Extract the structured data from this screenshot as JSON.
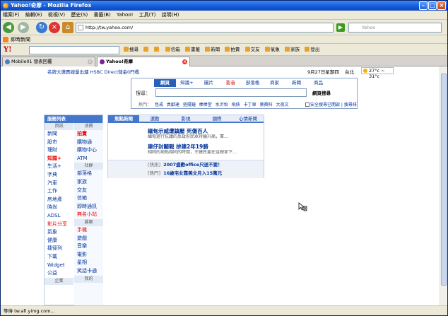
{
  "window": {
    "title": "Yahoo!奇摩 - Mozilla Firefox"
  },
  "menu": [
    "檔案(F)",
    "編輯(E)",
    "檢視(V)",
    "歷史(S)",
    "書籤(B)",
    "Yahoo!",
    "工具(T)",
    "說明(H)"
  ],
  "nav": {
    "url": "http://tw.yahoo.com/",
    "search_placeholder": "Yahoo"
  },
  "bookmarks": {
    "item": "即時新聞"
  },
  "ytoolbar": {
    "items": [
      "搜尋",
      "",
      "",
      "信箱",
      "書籤",
      "新聞",
      "拍賣",
      "交友",
      "氣象",
      "家族",
      "登出"
    ]
  },
  "tabs": [
    {
      "label": "Mobile01 發表回覆",
      "active": false
    },
    {
      "label": "Yahoo!奇摩",
      "active": true
    }
  ],
  "page": {
    "promo": "名牌大讚賣總量出爐  HSBC Direct儲金0門檻",
    "date": "9月27日星期四",
    "city": "台北",
    "weather": "27°c ~ 31°c"
  },
  "search": {
    "tabs": [
      "網頁",
      "知識+",
      "圖片",
      "影音",
      "部落格",
      "商家",
      "新聞",
      "商品"
    ],
    "active_tab": "網頁",
    "label": "搜尋：",
    "button": "網頁搜尋",
    "hot_label": "熱門：",
    "hot": [
      "色戒",
      "貢獻達",
      "搭擺鐘",
      "棒棒堂",
      "水沂怡",
      "飛俠",
      "卡丁車",
      "蔡費科",
      "大夜文"
    ],
    "safe": "安全搜尋已開啟",
    "more": "搜尋排"
  },
  "services": {
    "title": "服務列表",
    "col1_head": "資訊",
    "col2_head": "消費",
    "col1": [
      {
        "t": "新聞"
      },
      {
        "t": "股市"
      },
      {
        "t": "理財"
      },
      {
        "t": "知識+",
        "red": true,
        "bold": true
      },
      {
        "t": "生活+"
      },
      {
        "t": "字典"
      },
      {
        "t": "汽車"
      },
      {
        "t": "工作"
      },
      {
        "t": "房地產"
      },
      {
        "t": "時尚"
      },
      {
        "t": "ADSL"
      },
      {
        "t": "影片分享",
        "red": true
      },
      {
        "t": "氣象"
      },
      {
        "t": "健康"
      },
      {
        "t": "捷徑列"
      },
      {
        "t": "下載"
      },
      {
        "t": "Widget"
      },
      {
        "t": "公益"
      }
    ],
    "col2": [
      {
        "t": "拍賣",
        "red": true,
        "bold": true
      },
      {
        "t": "購物通"
      },
      {
        "t": "購物中心"
      },
      {
        "t": "ATM"
      },
      {
        "t": "社群",
        "head": true
      },
      {
        "t": "部落格"
      },
      {
        "t": "家族"
      },
      {
        "t": "交友"
      },
      {
        "t": "信箱"
      },
      {
        "t": "即時通訊"
      },
      {
        "t": "無名小站",
        "red": true
      },
      {
        "t": "娛樂",
        "head": true
      },
      {
        "t": "手機",
        "red": true
      },
      {
        "t": "遊戲"
      },
      {
        "t": "音樂"
      },
      {
        "t": "電影"
      },
      {
        "t": "星相"
      },
      {
        "t": "笑話卡通"
      }
    ],
    "foot1": "企業",
    "foot2": "我的"
  },
  "news": {
    "tabs": [
      "焦點新聞",
      "運動",
      "影視",
      "國際",
      "心情新聞"
    ],
    "story1": {
      "title": "緬甸示威遭鎮壓 死傷百人",
      "desc": "緬甸遊行抗議的反政府民眾持續升高，軍…"
    },
    "story2": {
      "title": "建仔封關戰 拚建2年19勝",
      "desc": "相同的地點相同的時間，王建民要在這裡拿下…"
    },
    "headlines": [
      {
        "tag": "[快訊]",
        "text": "2007盛歡office只送不要！"
      },
      {
        "tag": "[熱門]",
        "text": "16歲宅女靠美文月入15萬元"
      }
    ]
  },
  "status": {
    "text": "等待 tw.afi.yimg.com..."
  }
}
